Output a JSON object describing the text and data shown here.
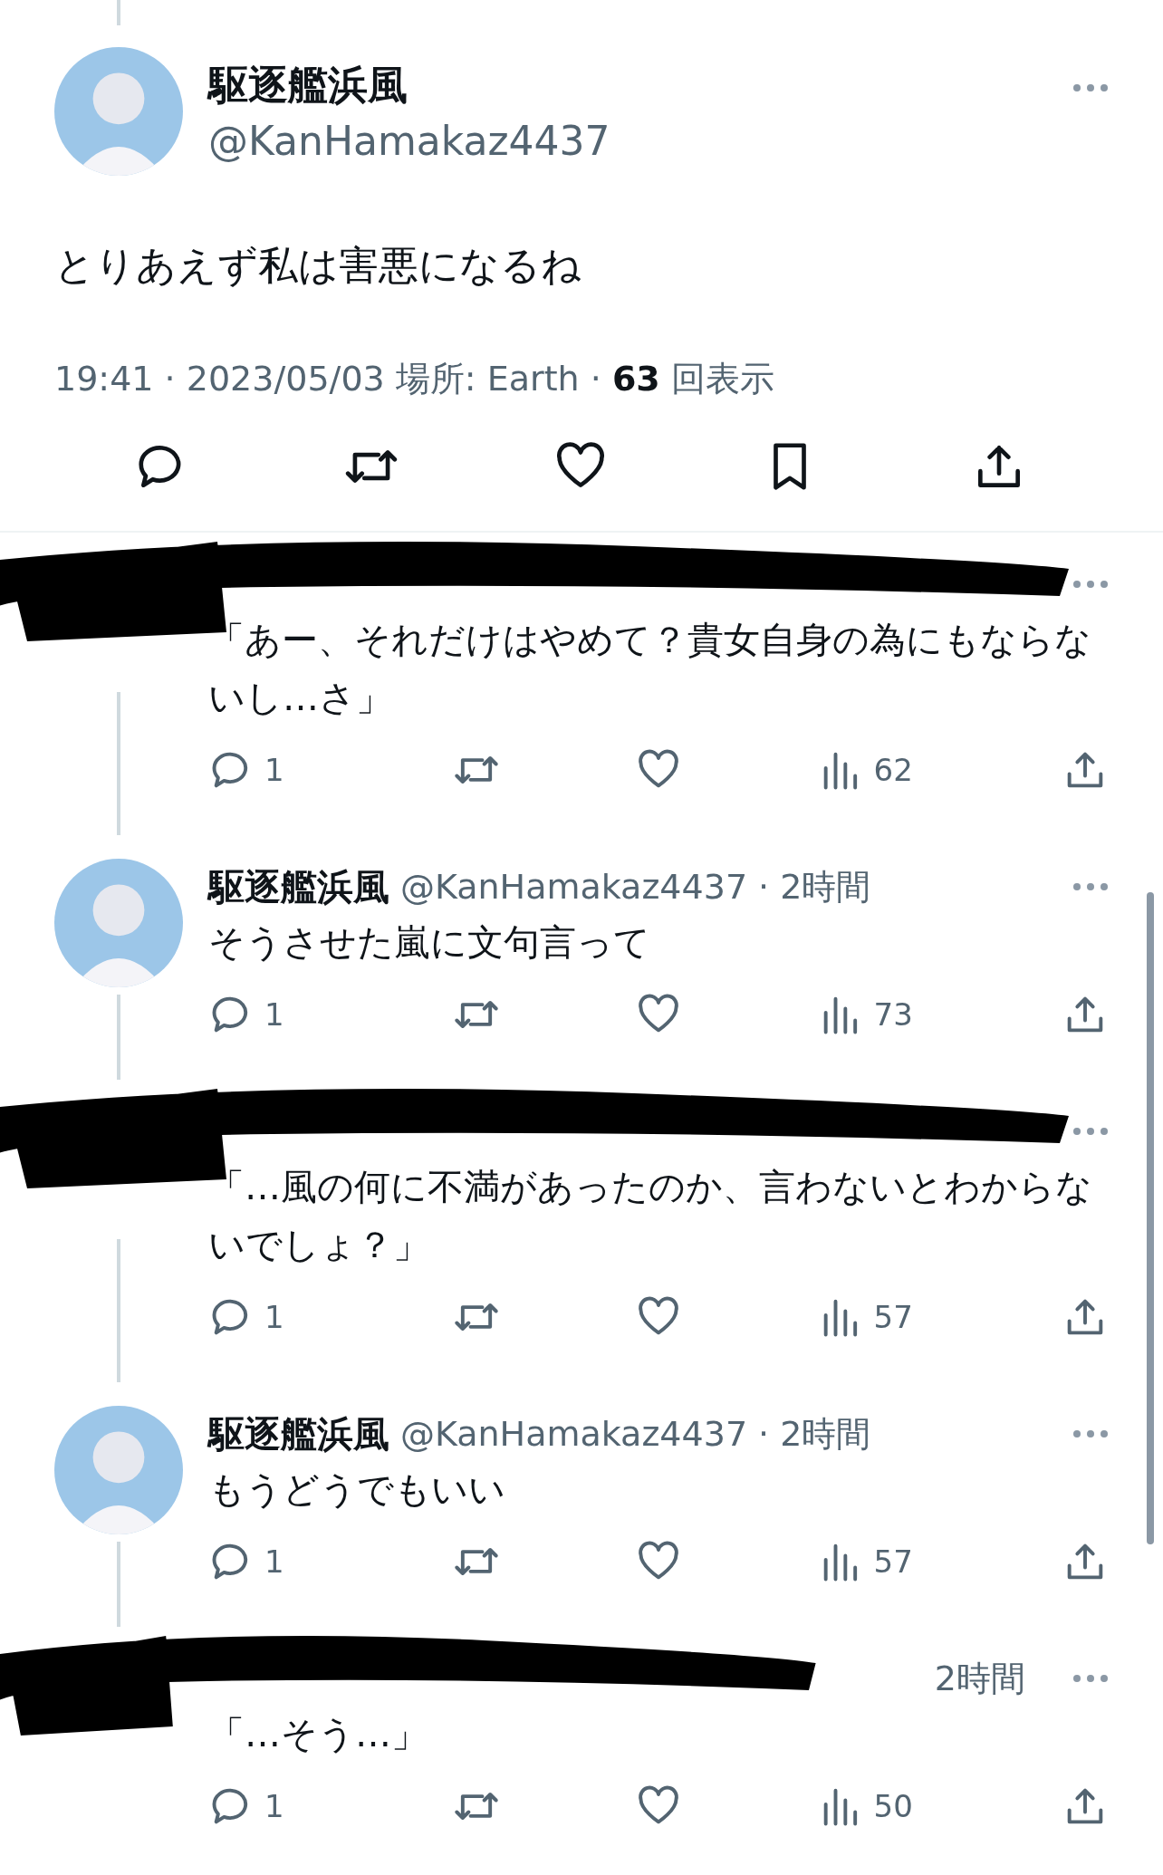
{
  "tweet": {
    "name": "駆逐艦浜風",
    "handle": "@KanHamakaz4437",
    "text": "とりあえず私は害悪になるね",
    "time": "19:41 · 2023/05/03 場所: Earth · ",
    "views": "63",
    "views_label": "回表示"
  },
  "replies": [
    {
      "kind": "redacted",
      "text": "「あー、それだけはやめて？貴女自身の為にもならないし…さ」",
      "reply_count": "1",
      "views": "62"
    },
    {
      "kind": "normal",
      "name": "駆逐艦浜風",
      "handle": "@KanHamakaz4437",
      "time": "· 2時間",
      "text": "そうさせた嵐に文句言って",
      "reply_count": "1",
      "views": "73"
    },
    {
      "kind": "redacted",
      "text": "「…風の何に不満があったのか、言わないとわからないでしょ？」",
      "reply_count": "1",
      "views": "57"
    },
    {
      "kind": "normal",
      "name": "駆逐艦浜風",
      "handle": "@KanHamakaz4437",
      "time": "· 2時間",
      "text": "もうどうでもいい",
      "reply_count": "1",
      "views": "57"
    },
    {
      "kind": "redacted",
      "time": "2時間",
      "text": "「…そう…」",
      "reply_count": "1",
      "views": "50"
    }
  ]
}
